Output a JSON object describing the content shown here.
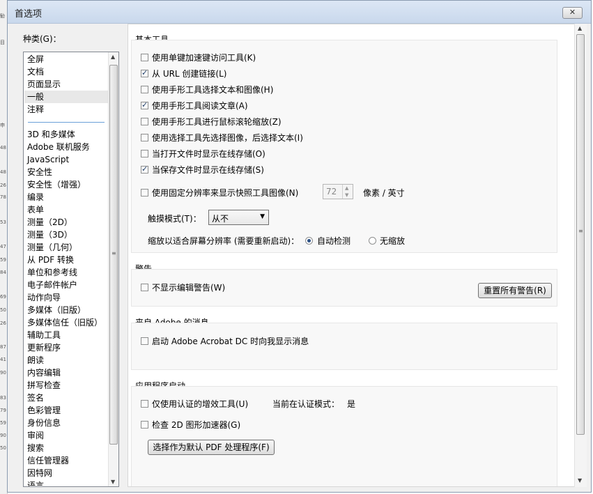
{
  "window": {
    "title": "首选项",
    "close_symbol": "✕"
  },
  "background_marks": [
    "勧",
    "目",
    "申",
    "48",
    "48",
    "26",
    "78",
    "53",
    "47",
    "59",
    "84",
    "69",
    "50",
    "26",
    "87",
    "41",
    "90",
    "83",
    "79",
    "59",
    "90",
    "50"
  ],
  "categories": {
    "label": "种类(G)：",
    "selected": "一般",
    "group1": [
      "全屏",
      "文档",
      "页面显示",
      "一般",
      "注释"
    ],
    "group2": [
      "3D 和多媒体",
      "Adobe 联机服务",
      "JavaScript",
      "安全性",
      "安全性（增强）",
      "编录",
      "表单",
      "测量（2D）",
      "测量（3D）",
      "测量（几何）",
      "从 PDF 转换",
      "单位和参考线",
      "电子邮件帐户",
      "动作向导",
      "多媒体（旧版）",
      "多媒体信任（旧版）",
      "辅助工具",
      "更新程序",
      "朗读",
      "内容编辑",
      "拼写检查",
      "签名",
      "色彩管理",
      "身份信息",
      "审阅",
      "搜索",
      "信任管理器",
      "因特网",
      "语言"
    ]
  },
  "basic_tools": {
    "title": "基本工具",
    "options": [
      {
        "label": "使用单键加速键访问工具(K)",
        "checked": false
      },
      {
        "label": "从 URL 创建链接(L)",
        "checked": true
      },
      {
        "label": "使用手形工具选择文本和图像(H)",
        "checked": false
      },
      {
        "label": "使用手形工具阅读文章(A)",
        "checked": true
      },
      {
        "label": "使用手形工具进行鼠标滚轮缩放(Z)",
        "checked": false
      },
      {
        "label": "使用选择工具先选择图像，后选择文本(I)",
        "checked": false
      },
      {
        "label": "当打开文件时显示在线存储(O)",
        "checked": false
      },
      {
        "label": "当保存文件时显示在线存储(S)",
        "checked": true
      }
    ],
    "snapshot": {
      "label": "使用固定分辨率来显示快照工具图像(N)",
      "checked": false,
      "value": "72",
      "unit": "像素 / 英寸"
    },
    "touch_mode": {
      "label": "触摸模式(T)：",
      "value": "从不"
    },
    "scaling": {
      "label": "缩放以适合屏幕分辨率 (需要重新启动)：",
      "options": [
        "自动检测",
        "无缩放"
      ],
      "selected": "自动检测"
    }
  },
  "warnings": {
    "title": "警告",
    "option": {
      "label": "不显示编辑警告(W)",
      "checked": false
    },
    "reset_button": "重置所有警告(R)"
  },
  "adobe_messages": {
    "title": "来自 Adobe 的消息",
    "option": {
      "label": "启动 Adobe Acrobat DC 时向我显示消息",
      "checked": false
    }
  },
  "app_startup": {
    "title": "应用程序启动",
    "certified": {
      "label": "仅使用认证的增效工具(U)",
      "checked": false
    },
    "cert_mode_label": "当前在认证模式：",
    "cert_mode_value": "是",
    "gpu": {
      "label": "检查 2D 图形加速器(G)",
      "checked": false
    },
    "default_pdf_button": "选择作为默认 PDF 处理程序(F)"
  },
  "colors": {
    "titlebar": "#c9d8ec",
    "window_bg": "#f0f0f0",
    "check": "#1f3f6b",
    "separator": "#6aa0d8"
  }
}
